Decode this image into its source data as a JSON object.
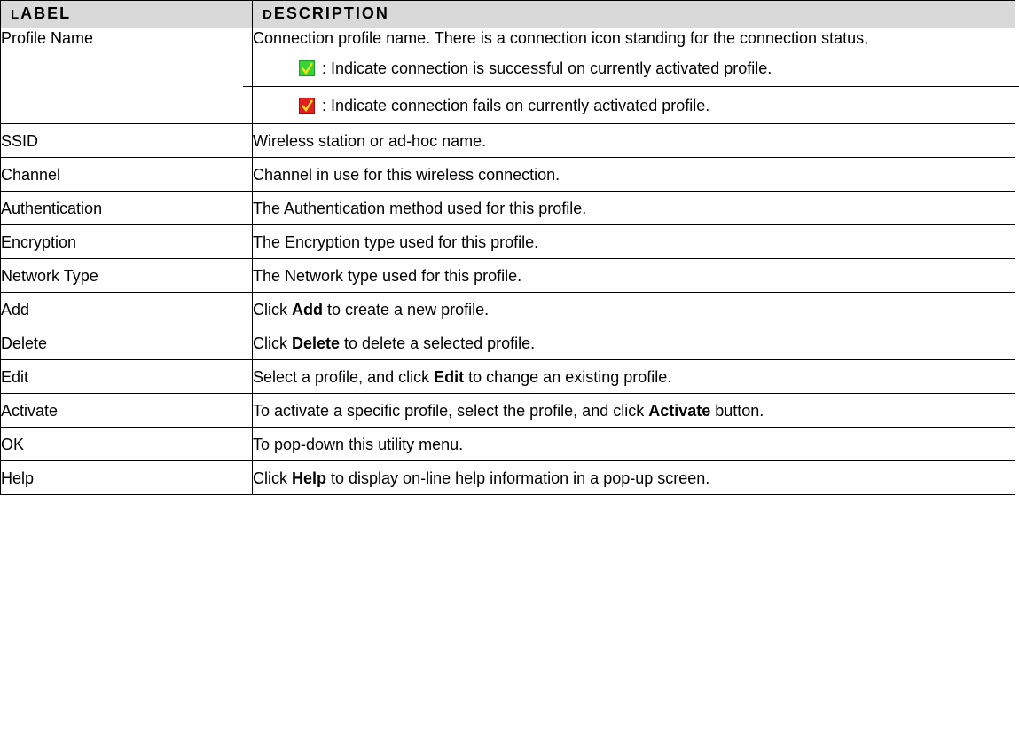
{
  "header": {
    "label_first": "L",
    "label_rest": "ABEL",
    "description_first": "D",
    "description_rest": "ESCRIPTION"
  },
  "profile_row": {
    "label": "Profile Name",
    "description": "Connection profile name. There is a connection icon standing for the connection status,",
    "status_success_icon": "green-check-icon",
    "status_success_text": ": Indicate connection is successful on currently activated profile.",
    "status_fail_icon": "red-check-icon",
    "status_fail_text": ": Indicate connection fails on currently activated profile."
  },
  "rows": [
    {
      "label": "SSID",
      "text": "Wireless station or ad-hoc name."
    },
    {
      "label": "Channel",
      "text": "Channel in use for this wireless connection."
    },
    {
      "label": "Authentication",
      "text": "The Authentication method used for this profile."
    },
    {
      "label": "Encryption",
      "text": "The Encryption type used for this profile."
    },
    {
      "label": "Network Type",
      "text": "The Network type used for this profile."
    },
    {
      "label": "Add",
      "pre": "Click ",
      "bold": "Add",
      "post": " to create a new profile."
    },
    {
      "label": "Delete",
      "pre": "Click ",
      "bold": "Delete",
      "post": " to delete a selected profile."
    },
    {
      "label": "Edit",
      "pre": "Select a profile, and click ",
      "bold": "Edit",
      "post": " to change an existing profile."
    },
    {
      "label": "Activate",
      "pre": "To activate a specific profile, select the profile, and click ",
      "bold": "Activate",
      "post": " button."
    },
    {
      "label": "OK",
      "text": "To pop-down this utility menu."
    },
    {
      "label": "Help",
      "pre": "Click ",
      "bold": "Help",
      "post": " to display on-line help information in a pop-up screen."
    }
  ],
  "colors": {
    "header_bg": "#d9d9d9",
    "success": "#38d23a",
    "fail": "#e21e1e",
    "check": "#f2e21a"
  }
}
